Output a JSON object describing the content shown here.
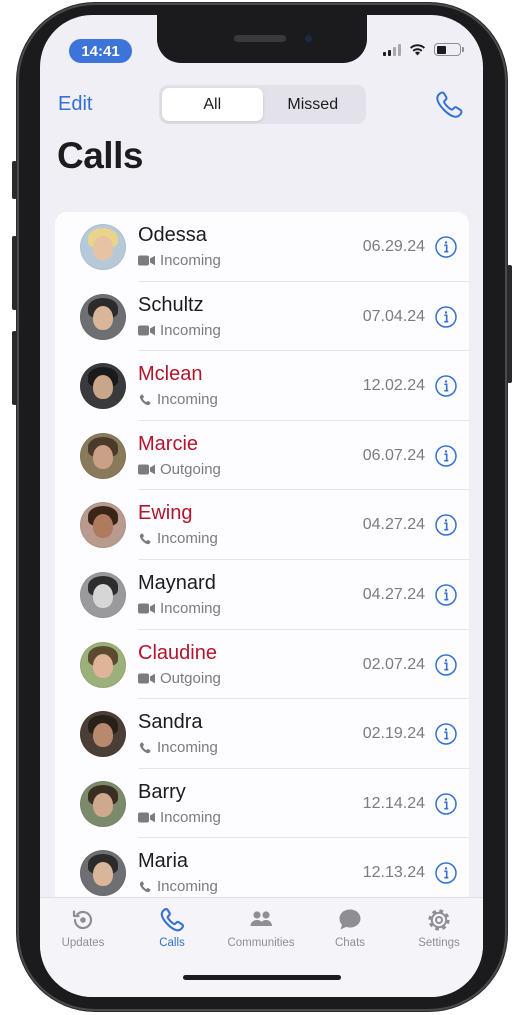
{
  "status_bar": {
    "time": "14:41"
  },
  "header": {
    "edit_label": "Edit",
    "segments": [
      {
        "label": "All",
        "active": true
      },
      {
        "label": "Missed",
        "active": false
      }
    ],
    "title": "Calls"
  },
  "calls": [
    {
      "name": "Odessa",
      "call_kind": "video",
      "direction": "Incoming",
      "date": "06.29.24",
      "missed": false
    },
    {
      "name": "Schultz",
      "call_kind": "video",
      "direction": "Incoming",
      "date": "07.04.24",
      "missed": false
    },
    {
      "name": "Mclean",
      "call_kind": "audio",
      "direction": "Incoming",
      "date": "12.02.24",
      "missed": true
    },
    {
      "name": "Marcie",
      "call_kind": "video",
      "direction": "Outgoing",
      "date": "06.07.24",
      "missed": true
    },
    {
      "name": "Ewing",
      "call_kind": "audio",
      "direction": "Incoming",
      "date": "04.27.24",
      "missed": true
    },
    {
      "name": "Maynard",
      "call_kind": "video",
      "direction": "Incoming",
      "date": "04.27.24",
      "missed": false
    },
    {
      "name": "Claudine",
      "call_kind": "video",
      "direction": "Outgoing",
      "date": "02.07.24",
      "missed": true
    },
    {
      "name": "Sandra",
      "call_kind": "audio",
      "direction": "Incoming",
      "date": "02.19.24",
      "missed": false
    },
    {
      "name": "Barry",
      "call_kind": "video",
      "direction": "Incoming",
      "date": "12.14.24",
      "missed": false
    },
    {
      "name": "Maria",
      "call_kind": "audio",
      "direction": "Incoming",
      "date": "12.13.24",
      "missed": false
    }
  ],
  "tab_bar": {
    "tabs": [
      {
        "label": "Updates",
        "icon": "updates-icon",
        "active": false
      },
      {
        "label": "Calls",
        "icon": "phone-icon",
        "active": true
      },
      {
        "label": "Communities",
        "icon": "communities-icon",
        "active": false
      },
      {
        "label": "Chats",
        "icon": "chats-icon",
        "active": false
      },
      {
        "label": "Settings",
        "icon": "settings-icon",
        "active": false
      }
    ]
  },
  "colors": {
    "accent": "#3471d1",
    "missed": "#b3152b",
    "time_pill": "#3d74d9",
    "background": "#f0eff6"
  }
}
